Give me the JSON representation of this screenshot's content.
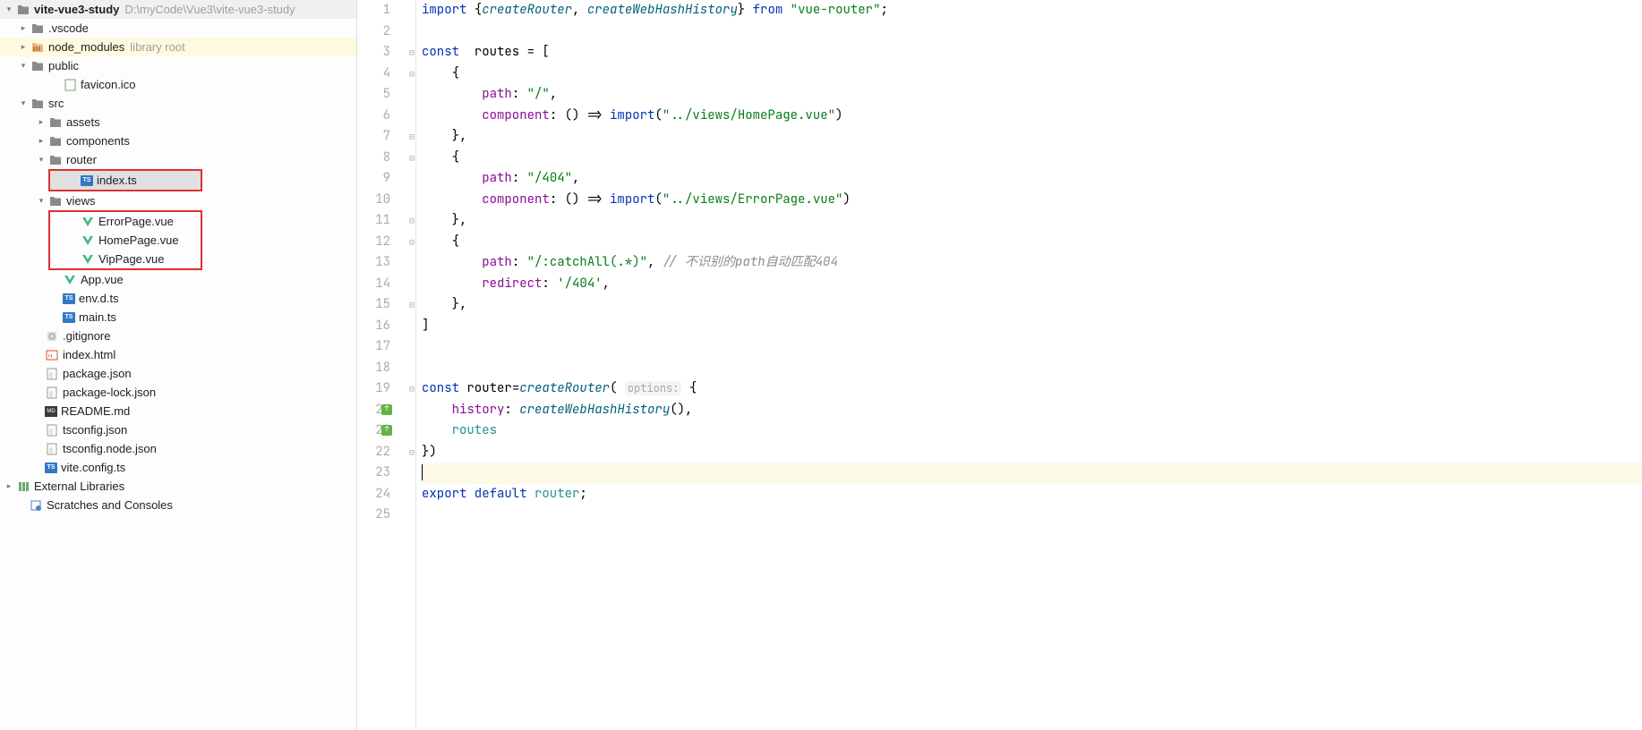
{
  "tree": {
    "root_name": "vite-vue3-study",
    "root_path": "D:\\myCode\\Vue3\\vite-vue3-study",
    "vscode": ".vscode",
    "node_modules": "node_modules",
    "node_modules_hint": "library root",
    "public": "public",
    "favicon": "favicon.ico",
    "src": "src",
    "assets": "assets",
    "components": "components",
    "router": "router",
    "index_ts": "index.ts",
    "views": "views",
    "error_page": "ErrorPage.vue",
    "home_page": "HomePage.vue",
    "vip_page": "VipPage.vue",
    "app_vue": "App.vue",
    "env_d_ts": "env.d.ts",
    "main_ts": "main.ts",
    "gitignore": ".gitignore",
    "index_html": "index.html",
    "package_json": "package.json",
    "package_lock": "package-lock.json",
    "readme": "README.md",
    "tsconfig": "tsconfig.json",
    "tsconfig_node": "tsconfig.node.json",
    "vite_config": "vite.config.ts",
    "external_libs": "External Libraries",
    "scratches": "Scratches and Consoles"
  },
  "code": {
    "line1_import": "import",
    "line1_open": " {",
    "line1_item1": "createRouter",
    "line1_comma": ", ",
    "line1_item2": "createWebHashHistory",
    "line1_close": "} ",
    "line1_from": "from",
    "line1_str": " \"vue-router\"",
    "line1_semi": ";",
    "line3_const": "const",
    "line3_routes": "  routes ",
    "line3_eq": "= [",
    "line4": "    {",
    "line5_path": "        path",
    "line5_colon": ": ",
    "line5_str": "\"/\"",
    "line5_comma": ",",
    "line6_comp": "        component",
    "line6_colon": ": () => ",
    "line6_import": "import",
    "line6_open": "(",
    "line6_str": "\"../views/HomePage.vue\"",
    "line6_close": ")",
    "line7": "    },",
    "line8": "    {",
    "line9_path": "        path",
    "line9_colon": ": ",
    "line9_str": "\"/404\"",
    "line9_comma": ",",
    "line10_comp": "        component",
    "line10_colon": ": () => ",
    "line10_import": "import",
    "line10_open": "(",
    "line10_str": "\"../views/ErrorPage.vue\"",
    "line10_close": ")",
    "line11": "    },",
    "line12": "    {",
    "line13_path": "        path",
    "line13_colon": ": ",
    "line13_str": "\"/:catchAll(.*)\"",
    "line13_comma": ", ",
    "line13_comment": "// 不识别的path自动匹配404",
    "line14_redir": "        redirect",
    "line14_colon": ": ",
    "line14_str": "'/404'",
    "line14_comma": ",",
    "line15": "    },",
    "line16": "]",
    "line19_const": "const",
    "line19_router": " router",
    "line19_eq": "=",
    "line19_create": "createRouter",
    "line19_open": "( ",
    "line19_hint": "options:",
    "line19_brace": " {",
    "line20_hist": "    history",
    "line20_colon": ": ",
    "line20_func": "createWebHashHistory",
    "line20_paren": "(),",
    "line21_routes": "    routes",
    "line22": "})",
    "line24_export": "export",
    "line24_default": " default",
    "line24_router": " router",
    "line24_semi": ";"
  },
  "line_numbers": [
    "1",
    "2",
    "3",
    "4",
    "5",
    "6",
    "7",
    "8",
    "9",
    "10",
    "11",
    "12",
    "13",
    "14",
    "15",
    "16",
    "17",
    "18",
    "19",
    "20",
    "21",
    "22",
    "23",
    "24",
    "25"
  ]
}
